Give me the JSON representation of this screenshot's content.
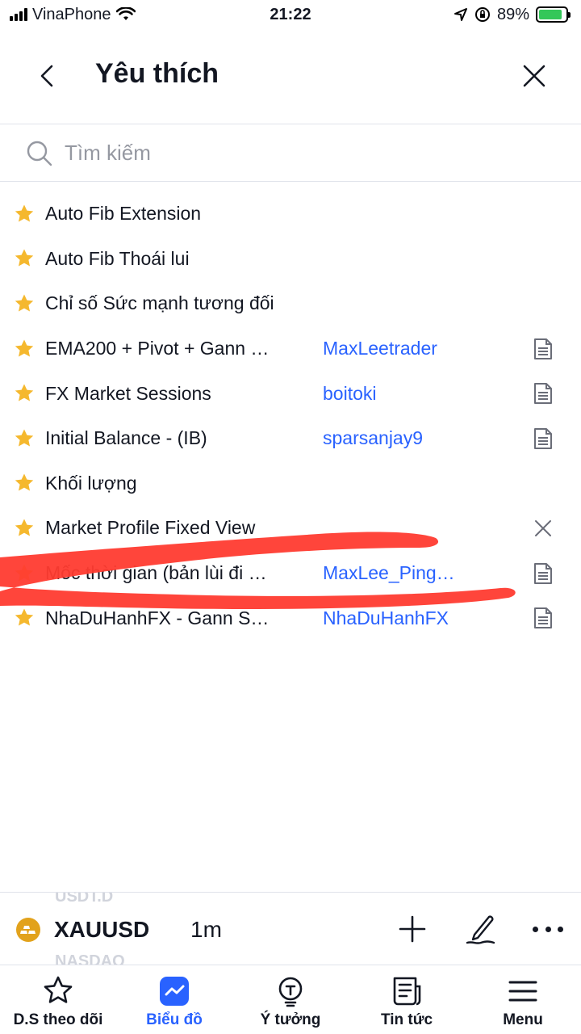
{
  "status_bar": {
    "carrier": "VinaPhone",
    "time": "21:22",
    "battery": "89%",
    "battery_level": 0.89
  },
  "header": {
    "title": "Yêu thích"
  },
  "search": {
    "placeholder": "Tìm kiếm"
  },
  "items": [
    {
      "name": "Auto Fib Extension",
      "author": "",
      "action": ""
    },
    {
      "name": "Auto Fib Thoái lui",
      "author": "",
      "action": ""
    },
    {
      "name": "Chỉ số Sức mạnh tương đối",
      "author": "",
      "action": ""
    },
    {
      "name": "EMA200 + Pivot + Gann …",
      "author": "MaxLeetrader",
      "action": "document-icon"
    },
    {
      "name": "FX Market Sessions",
      "author": "boitoki",
      "action": "document-icon"
    },
    {
      "name": "Initial Balance - (IB)",
      "author": "sparsanjay9",
      "action": "document-icon"
    },
    {
      "name": "Khối lượng",
      "author": "",
      "action": ""
    },
    {
      "name": "Market Profile Fixed View",
      "author": "",
      "action": "remove-icon"
    },
    {
      "name": "Mốc thời gian (bản lùi đi …",
      "author": "MaxLee_Ping…",
      "action": "document-icon"
    },
    {
      "name": "NhaDuHanhFX - Gann S…",
      "author": "NhaDuHanhFX",
      "action": "document-icon"
    }
  ],
  "chart_bar": {
    "ghost_top": "USDT.D",
    "ghost_bottom": "NASDAQ",
    "symbol": "XAUUSD",
    "interval": "1m"
  },
  "tabs": [
    {
      "label": "D.S theo dõi",
      "icon": "star-icon",
      "active": false
    },
    {
      "label": "Biểu đồ",
      "icon": "chart-icon",
      "active": true
    },
    {
      "label": "Ý tưởng",
      "icon": "lightbulb-icon",
      "active": false
    },
    {
      "label": "Tin tức",
      "icon": "news-icon",
      "active": false
    },
    {
      "label": "Menu",
      "icon": "menu-icon",
      "active": false
    }
  ],
  "colors": {
    "star": "#f5b82e",
    "link": "#2962ff",
    "active_tab": "#2962ff",
    "scribble": "#ff3b30",
    "battery": "#34c759"
  }
}
